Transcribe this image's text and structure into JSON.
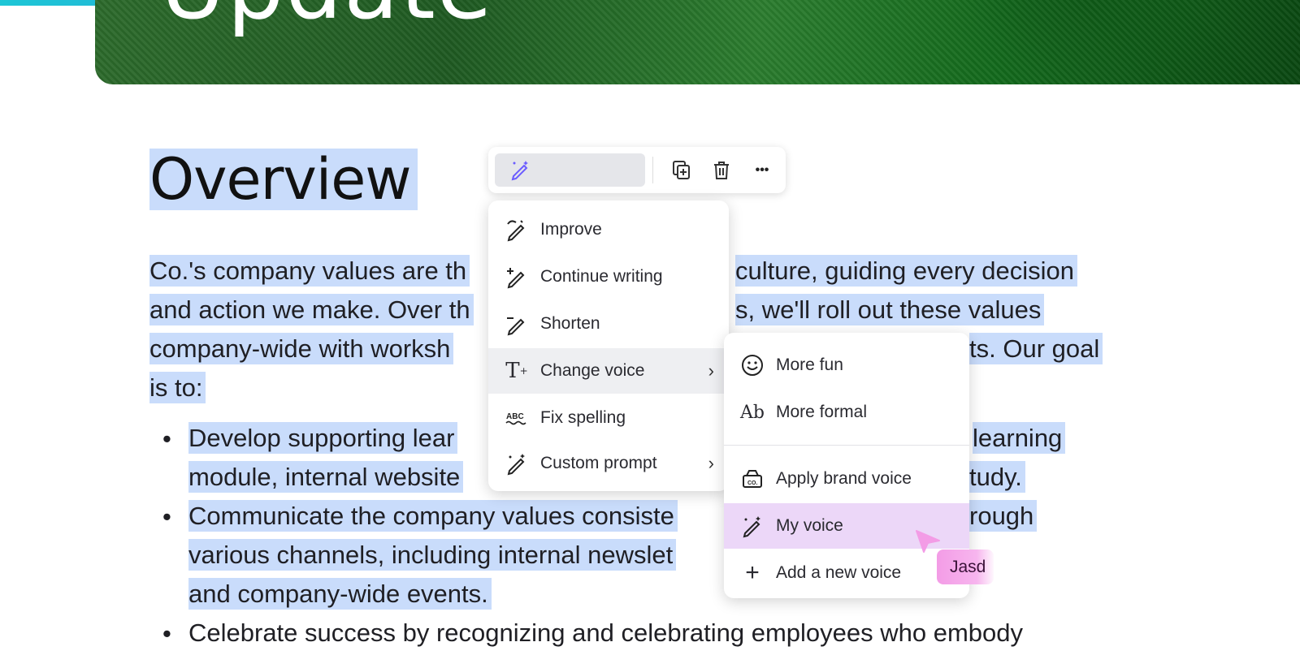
{
  "hero": {
    "title": "Update"
  },
  "document": {
    "heading": "Overview",
    "paragraph_lines": [
      [
        "Co.'s company values are th",
        "culture, guiding every decision"
      ],
      [
        "and action we make. Over th",
        "s, we'll roll out these values"
      ],
      [
        "company-wide with worksh",
        "ts. Our goal"
      ],
      [
        "is to:",
        ""
      ]
    ],
    "bullets": [
      {
        "lines": [
          [
            "Develop supporting lear",
            "learning"
          ],
          [
            "module, internal website",
            "tudy."
          ]
        ]
      },
      {
        "lines": [
          [
            "Communicate the company values consiste",
            "rough"
          ],
          [
            "various channels, including internal newslet",
            ""
          ],
          [
            "and company-wide events.",
            ""
          ]
        ]
      },
      {
        "lines": [
          [
            "Celebrate success by recognizing and celebrating employees who embody",
            ""
          ]
        ]
      }
    ]
  },
  "toolbar": {
    "icons": [
      "magic-pen-icon",
      "copy-add-icon",
      "trash-icon",
      "more-icon"
    ],
    "more_label": "•••"
  },
  "ai_menu": {
    "items": [
      {
        "label": "Improve",
        "icon": "improve-icon"
      },
      {
        "label": "Continue writing",
        "icon": "continue-writing-icon"
      },
      {
        "label": "Shorten",
        "icon": "shorten-icon"
      },
      {
        "label": "Change voice",
        "icon": "change-voice-icon",
        "submenu": true
      },
      {
        "label": "Fix spelling",
        "icon": "fix-spelling-icon"
      },
      {
        "label": "Custom prompt",
        "icon": "custom-prompt-icon",
        "submenu": true
      }
    ],
    "chevron": "›"
  },
  "voice_menu": {
    "items": [
      {
        "label": "More fun",
        "icon": "smiley-icon"
      },
      {
        "label": "More formal",
        "icon": "ab-text-icon",
        "icon_text": "Ab"
      },
      {
        "label": "Apply brand voice",
        "icon": "brand-kit-icon"
      },
      {
        "label": "My voice",
        "icon": "magic-pen-icon"
      },
      {
        "label": "Add a new voice",
        "icon": "plus-icon",
        "icon_text": "+"
      }
    ]
  },
  "collaborator": {
    "name": "Jasd"
  },
  "colors": {
    "selection": "#c9dcfb",
    "active_item": "#ecd7f8",
    "cursor": "#f39ce6"
  }
}
